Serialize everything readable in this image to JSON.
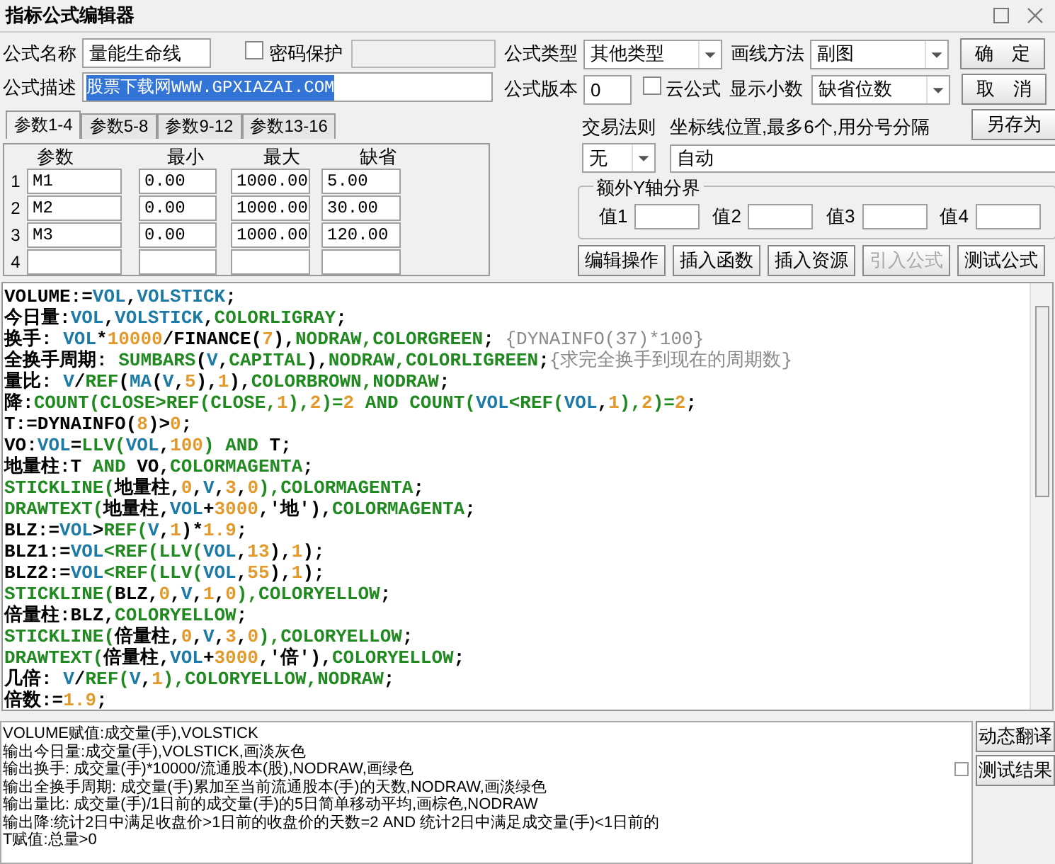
{
  "window": {
    "title": "指标公式编辑器"
  },
  "form": {
    "name_label": "公式名称",
    "name_value": "量能生命线",
    "password": {
      "label": "密码保护",
      "checked": false
    },
    "desc_label": "公式描述",
    "desc_value": "股票下载网WWW.GPXIAZAI.COM",
    "desc_selected": true,
    "type_label": "公式类型",
    "type_value": "其他类型",
    "draw_label": "画线方法",
    "draw_value": "副图",
    "version_label": "公式版本",
    "version_value": "0",
    "cloud": {
      "label": "云公式",
      "checked": false
    },
    "decimal_label": "显示小数",
    "decimal_value": "缺省位数"
  },
  "buttons": [
    {
      "label": "确　定"
    },
    {
      "label": "取　消"
    },
    {
      "label": "另存为"
    }
  ],
  "tabs": [
    {
      "label": "参数1-4",
      "selected": true
    },
    {
      "label": "参数5-8",
      "selected": false
    },
    {
      "label": "参数9-12",
      "selected": false
    },
    {
      "label": "参数13-16",
      "selected": false
    }
  ],
  "params": {
    "columns": [
      "参数",
      "最小",
      "最大",
      "缺省"
    ],
    "rows": [
      {
        "number": "1",
        "values": [
          "M1",
          "0.00",
          "1000.00",
          "5.00"
        ]
      },
      {
        "number": "2",
        "values": [
          "M2",
          "0.00",
          "1000.00",
          "30.00"
        ]
      },
      {
        "number": "3",
        "values": [
          "M3",
          "0.00",
          "1000.00",
          "120.00"
        ]
      },
      {
        "number": "4",
        "values": []
      }
    ]
  },
  "trade": {
    "label": "交易法则",
    "value": "无"
  },
  "axis": {
    "label": "坐标线位置,最多6个,用分号分隔",
    "value": "自动"
  },
  "y_bounds": {
    "title": "额外Y轴分界",
    "fields": [
      {
        "label": "值1"
      },
      {
        "label": "值2"
      },
      {
        "label": "值3"
      },
      {
        "label": "值4"
      }
    ]
  },
  "actions": [
    {
      "label": "编辑操作",
      "disabled": false
    },
    {
      "label": "插入函数",
      "disabled": false
    },
    {
      "label": "插入资源",
      "disabled": false
    },
    {
      "label": "引入公式",
      "disabled": true
    },
    {
      "label": "测试公式",
      "disabled": false
    }
  ],
  "code": [
    [
      {
        "kind": "name",
        "text": "VOLUME:="
      },
      {
        "kind": "data",
        "text": "VOL"
      },
      {
        "kind": "name",
        "text": ","
      },
      {
        "kind": "data",
        "text": "VOLSTICK"
      },
      {
        "kind": "name",
        "text": ";"
      }
    ],
    [
      {
        "kind": "name",
        "text": "今日量:"
      },
      {
        "kind": "data",
        "text": "VOL"
      },
      {
        "kind": "name",
        "text": ","
      },
      {
        "kind": "data",
        "text": "VOLSTICK"
      },
      {
        "kind": "name",
        "text": ","
      },
      {
        "kind": "function",
        "text": "COLORLIGRAY"
      },
      {
        "kind": "name",
        "text": ";"
      }
    ],
    [
      {
        "kind": "name",
        "text": "换手: "
      },
      {
        "kind": "data",
        "text": "VOL"
      },
      {
        "kind": "name",
        "text": "*"
      },
      {
        "kind": "number",
        "text": "10000"
      },
      {
        "kind": "name",
        "text": "/FINANCE("
      },
      {
        "kind": "number",
        "text": "7"
      },
      {
        "kind": "name",
        "text": "),"
      },
      {
        "kind": "function",
        "text": "NODRAW,COLORGREEN"
      },
      {
        "kind": "name",
        "text": "; "
      },
      {
        "kind": "comment",
        "text": "{DYNAINFO(37)*100}"
      }
    ],
    [
      {
        "kind": "name",
        "text": "全换手周期: "
      },
      {
        "kind": "function",
        "text": "SUMBARS"
      },
      {
        "kind": "name",
        "text": "("
      },
      {
        "kind": "data",
        "text": "V"
      },
      {
        "kind": "name",
        "text": ","
      },
      {
        "kind": "function",
        "text": "CAPITAL"
      },
      {
        "kind": "name",
        "text": "),"
      },
      {
        "kind": "function",
        "text": "NODRAW,COLORLIGREEN"
      },
      {
        "kind": "name",
        "text": ";"
      },
      {
        "kind": "comment",
        "text": "{求完全换手到现在的周期数}"
      }
    ],
    [
      {
        "kind": "name",
        "text": "量比: "
      },
      {
        "kind": "data",
        "text": "V"
      },
      {
        "kind": "name",
        "text": "/"
      },
      {
        "kind": "function",
        "text": "REF"
      },
      {
        "kind": "name",
        "text": "("
      },
      {
        "kind": "data",
        "text": "MA"
      },
      {
        "kind": "name",
        "text": "("
      },
      {
        "kind": "data",
        "text": "V"
      },
      {
        "kind": "name",
        "text": ","
      },
      {
        "kind": "number",
        "text": "5"
      },
      {
        "kind": "name",
        "text": "),"
      },
      {
        "kind": "number",
        "text": "1"
      },
      {
        "kind": "name",
        "text": "),"
      },
      {
        "kind": "function",
        "text": "COLORBROWN,NODRAW"
      },
      {
        "kind": "name",
        "text": ";"
      }
    ],
    [
      {
        "kind": "name",
        "text": "降:"
      },
      {
        "kind": "function",
        "text": "COUNT(CLOSE>REF(CLOSE,"
      },
      {
        "kind": "number",
        "text": "1"
      },
      {
        "kind": "function",
        "text": "),"
      },
      {
        "kind": "number",
        "text": "2"
      },
      {
        "kind": "function",
        "text": ")="
      },
      {
        "kind": "number",
        "text": "2"
      },
      {
        "kind": "function",
        "text": " AND COUNT("
      },
      {
        "kind": "data",
        "text": "VOL"
      },
      {
        "kind": "function",
        "text": "<REF("
      },
      {
        "kind": "data",
        "text": "VOL"
      },
      {
        "kind": "name",
        "text": ","
      },
      {
        "kind": "number",
        "text": "1"
      },
      {
        "kind": "function",
        "text": "),"
      },
      {
        "kind": "number",
        "text": "2"
      },
      {
        "kind": "function",
        "text": ")="
      },
      {
        "kind": "number",
        "text": "2"
      },
      {
        "kind": "name",
        "text": ";"
      }
    ],
    [
      {
        "kind": "name",
        "text": "T:=DYNAINFO("
      },
      {
        "kind": "number",
        "text": "8"
      },
      {
        "kind": "name",
        "text": ")>"
      },
      {
        "kind": "number",
        "text": "0"
      },
      {
        "kind": "name",
        "text": ";"
      }
    ],
    [
      {
        "kind": "name",
        "text": "VO:"
      },
      {
        "kind": "data",
        "text": "VOL"
      },
      {
        "kind": "name",
        "text": "="
      },
      {
        "kind": "function",
        "text": "LLV("
      },
      {
        "kind": "data",
        "text": "VOL"
      },
      {
        "kind": "name",
        "text": ","
      },
      {
        "kind": "number",
        "text": "100"
      },
      {
        "kind": "function",
        "text": ") AND "
      },
      {
        "kind": "name",
        "text": "T;"
      }
    ],
    [
      {
        "kind": "name",
        "text": "地量柱:T "
      },
      {
        "kind": "function",
        "text": "AND"
      },
      {
        "kind": "name",
        "text": " VO,"
      },
      {
        "kind": "function",
        "text": "COLORMAGENTA"
      },
      {
        "kind": "name",
        "text": ";"
      }
    ],
    [
      {
        "kind": "function",
        "text": "STICKLINE("
      },
      {
        "kind": "name",
        "text": "地量柱,"
      },
      {
        "kind": "number",
        "text": "0"
      },
      {
        "kind": "name",
        "text": ","
      },
      {
        "kind": "data",
        "text": "V"
      },
      {
        "kind": "name",
        "text": ","
      },
      {
        "kind": "number",
        "text": "3"
      },
      {
        "kind": "name",
        "text": ","
      },
      {
        "kind": "number",
        "text": "0"
      },
      {
        "kind": "function",
        "text": "),COLORMAGENTA"
      },
      {
        "kind": "name",
        "text": ";"
      }
    ],
    [
      {
        "kind": "function",
        "text": "DRAWTEXT("
      },
      {
        "kind": "name",
        "text": "地量柱,"
      },
      {
        "kind": "data",
        "text": "VOL"
      },
      {
        "kind": "name",
        "text": "+"
      },
      {
        "kind": "number",
        "text": "3000"
      },
      {
        "kind": "name",
        "text": ",'地'),"
      },
      {
        "kind": "function",
        "text": "COLORMAGENTA"
      },
      {
        "kind": "name",
        "text": ";"
      }
    ],
    [
      {
        "kind": "name",
        "text": "BLZ:="
      },
      {
        "kind": "data",
        "text": "VOL"
      },
      {
        "kind": "name",
        "text": ">"
      },
      {
        "kind": "function",
        "text": "REF("
      },
      {
        "kind": "data",
        "text": "V"
      },
      {
        "kind": "name",
        "text": ","
      },
      {
        "kind": "number",
        "text": "1"
      },
      {
        "kind": "name",
        "text": ")*"
      },
      {
        "kind": "number",
        "text": "1.9"
      },
      {
        "kind": "name",
        "text": ";"
      }
    ],
    [
      {
        "kind": "name",
        "text": "BLZ1:="
      },
      {
        "kind": "data",
        "text": "VOL"
      },
      {
        "kind": "function",
        "text": "<REF(LLV("
      },
      {
        "kind": "data",
        "text": "VOL"
      },
      {
        "kind": "name",
        "text": ","
      },
      {
        "kind": "number",
        "text": "13"
      },
      {
        "kind": "name",
        "text": "),"
      },
      {
        "kind": "number",
        "text": "1"
      },
      {
        "kind": "name",
        "text": ");"
      }
    ],
    [
      {
        "kind": "name",
        "text": "BLZ2:="
      },
      {
        "kind": "data",
        "text": "VOL"
      },
      {
        "kind": "function",
        "text": "<REF(LLV("
      },
      {
        "kind": "data",
        "text": "VOL"
      },
      {
        "kind": "name",
        "text": ","
      },
      {
        "kind": "number",
        "text": "55"
      },
      {
        "kind": "name",
        "text": "),"
      },
      {
        "kind": "number",
        "text": "1"
      },
      {
        "kind": "name",
        "text": ");"
      }
    ],
    [
      {
        "kind": "function",
        "text": "STICKLINE("
      },
      {
        "kind": "name",
        "text": "BLZ,"
      },
      {
        "kind": "number",
        "text": "0"
      },
      {
        "kind": "name",
        "text": ","
      },
      {
        "kind": "data",
        "text": "V"
      },
      {
        "kind": "name",
        "text": ","
      },
      {
        "kind": "number",
        "text": "1"
      },
      {
        "kind": "name",
        "text": ","
      },
      {
        "kind": "number",
        "text": "0"
      },
      {
        "kind": "function",
        "text": "),COLORYELLOW"
      },
      {
        "kind": "name",
        "text": ";"
      }
    ],
    [
      {
        "kind": "name",
        "text": "倍量柱:BLZ,"
      },
      {
        "kind": "function",
        "text": "COLORYELLOW"
      },
      {
        "kind": "name",
        "text": ";"
      }
    ],
    [
      {
        "kind": "function",
        "text": "STICKLINE("
      },
      {
        "kind": "name",
        "text": "倍量柱,"
      },
      {
        "kind": "number",
        "text": "0"
      },
      {
        "kind": "name",
        "text": ","
      },
      {
        "kind": "data",
        "text": "V"
      },
      {
        "kind": "name",
        "text": ","
      },
      {
        "kind": "number",
        "text": "3"
      },
      {
        "kind": "name",
        "text": ","
      },
      {
        "kind": "number",
        "text": "0"
      },
      {
        "kind": "function",
        "text": "),COLORYELLOW"
      },
      {
        "kind": "name",
        "text": ";"
      }
    ],
    [
      {
        "kind": "function",
        "text": "DRAWTEXT("
      },
      {
        "kind": "name",
        "text": "倍量柱,"
      },
      {
        "kind": "data",
        "text": "VOL"
      },
      {
        "kind": "name",
        "text": "+"
      },
      {
        "kind": "number",
        "text": "3000"
      },
      {
        "kind": "name",
        "text": ",'倍'),"
      },
      {
        "kind": "function",
        "text": "COLORYELLOW"
      },
      {
        "kind": "name",
        "text": ";"
      }
    ],
    [
      {
        "kind": "name",
        "text": "几倍: "
      },
      {
        "kind": "data",
        "text": "V"
      },
      {
        "kind": "name",
        "text": "/"
      },
      {
        "kind": "function",
        "text": "REF("
      },
      {
        "kind": "data",
        "text": "V"
      },
      {
        "kind": "name",
        "text": ","
      },
      {
        "kind": "number",
        "text": "1"
      },
      {
        "kind": "function",
        "text": "),COLORYELLOW,NODRAW"
      },
      {
        "kind": "name",
        "text": ";"
      }
    ],
    [
      {
        "kind": "name",
        "text": "倍数:="
      },
      {
        "kind": "number",
        "text": "1.9"
      },
      {
        "kind": "name",
        "text": ";"
      }
    ]
  ],
  "output": [
    "VOLUME赋值:成交量(手),VOLSTICK",
    "输出今日量:成交量(手),VOLSTICK,画淡灰色",
    "输出换手: 成交量(手)*10000/流通股本(股),NODRAW,画绿色",
    "输出全换手周期: 成交量(手)累加至当前流通股本(手)的天数,NODRAW,画淡绿色",
    "输出量比: 成交量(手)/1日前的成交量(手)的5日简单移动平均,画棕色,NODRAW",
    "输出降:统计2日中满足收盘价>1日前的收盘价的天数=2 AND 统计2日中满足成交量(手)<1日前的",
    "T赋值:总量>0"
  ],
  "side_buttons": [
    {
      "label": "动态翻译"
    },
    {
      "label": "测试结果"
    }
  ]
}
